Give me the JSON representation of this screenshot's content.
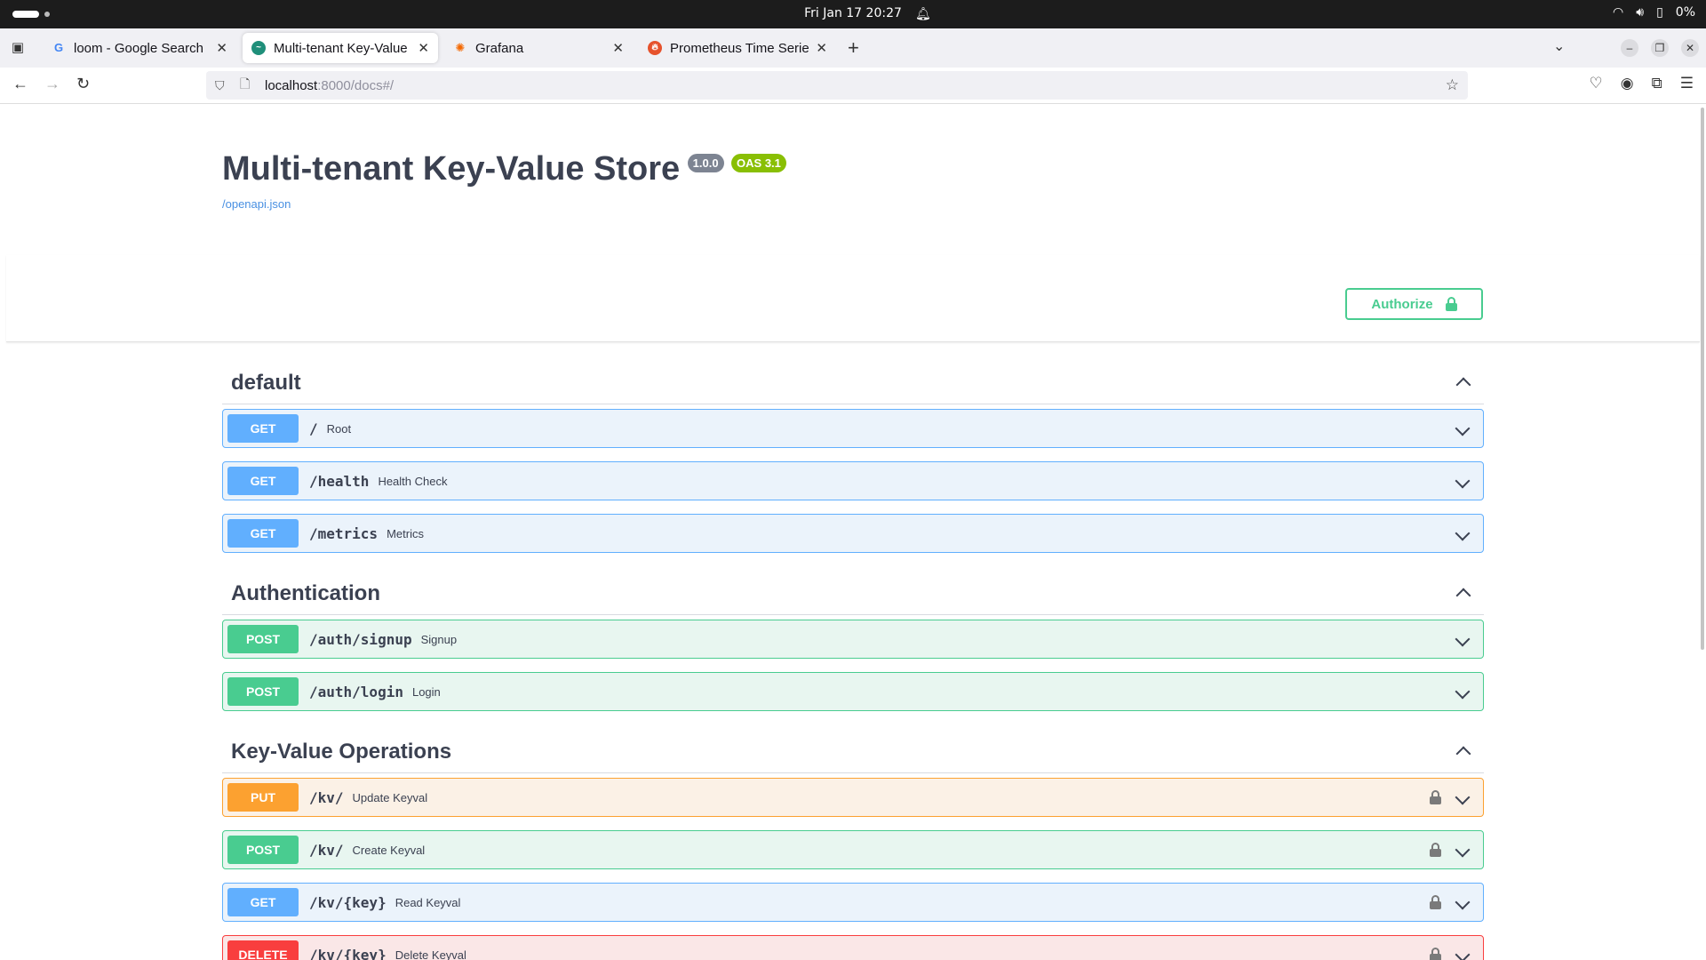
{
  "os": {
    "clock": "Fri Jan 17  20:27",
    "battery": "0%"
  },
  "browser": {
    "tabs": [
      {
        "title": "loom - Google Search",
        "favicon": "G",
        "favicon_color": "#4285f4"
      },
      {
        "title": "Multi-tenant Key-Value Store",
        "favicon": "",
        "favicon_color": "#1f8f7a"
      },
      {
        "title": "Grafana",
        "favicon": "",
        "favicon_color": "#f46800"
      },
      {
        "title": "Prometheus Time Series Collection",
        "favicon": "",
        "favicon_color": "#e6522c"
      }
    ],
    "url_host": "localhost",
    "url_path": ":8000/docs#/"
  },
  "api": {
    "title": "Multi-tenant Key-Value Store",
    "version": "1.0.0",
    "oas": "OAS 3.1",
    "spec_link": "/openapi.json",
    "authorize_label": "Authorize"
  },
  "sections": [
    {
      "name": "default",
      "operations": [
        {
          "method": "GET",
          "path": "/",
          "summary": "Root",
          "locked": false
        },
        {
          "method": "GET",
          "path": "/health",
          "summary": "Health Check",
          "locked": false
        },
        {
          "method": "GET",
          "path": "/metrics",
          "summary": "Metrics",
          "locked": false
        }
      ]
    },
    {
      "name": "Authentication",
      "operations": [
        {
          "method": "POST",
          "path": "/auth/signup",
          "summary": "Signup",
          "locked": false
        },
        {
          "method": "POST",
          "path": "/auth/login",
          "summary": "Login",
          "locked": false
        }
      ]
    },
    {
      "name": "Key-Value Operations",
      "operations": [
        {
          "method": "PUT",
          "path": "/kv/",
          "summary": "Update Keyval",
          "locked": true
        },
        {
          "method": "POST",
          "path": "/kv/",
          "summary": "Create Keyval",
          "locked": true
        },
        {
          "method": "GET",
          "path": "/kv/{key}",
          "summary": "Read Keyval",
          "locked": true
        },
        {
          "method": "DELETE",
          "path": "/kv/{key}",
          "summary": "Delete Keyval",
          "locked": true
        }
      ]
    }
  ],
  "colors": {
    "get": "#61affe",
    "post": "#49cc90",
    "put": "#fca130",
    "delete": "#f93e3e"
  }
}
